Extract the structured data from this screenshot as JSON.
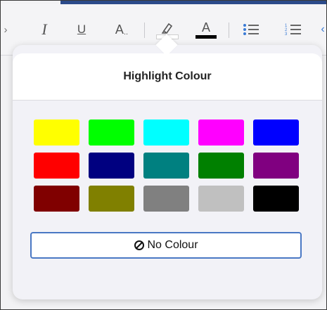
{
  "toolbar": {
    "items": [
      {
        "name": "italic-button",
        "glyph": "I"
      },
      {
        "name": "underline-button",
        "glyph": "U"
      },
      {
        "name": "text-effects-button",
        "glyph": "A.."
      },
      {
        "name": "highlight-button",
        "icon": "marker-icon"
      },
      {
        "name": "font-colour-button",
        "glyph": "A"
      },
      {
        "name": "bullet-list-button",
        "icon": "bullet-list-icon"
      },
      {
        "name": "numbered-list-button",
        "icon": "numbered-list-icon"
      }
    ],
    "font_colour_bar": "#000000"
  },
  "popover": {
    "title": "Highlight Colour",
    "swatches": [
      [
        "#ffff00",
        "#00ff00",
        "#00ffff",
        "#ff00ff",
        "#0000ff"
      ],
      [
        "#ff0000",
        "#000080",
        "#008080",
        "#008000",
        "#800080"
      ],
      [
        "#800000",
        "#808000",
        "#808080",
        "#c0c0c0",
        "#000000"
      ]
    ],
    "no_colour_label": "No Colour",
    "no_colour_icon": "prohibited-icon"
  }
}
